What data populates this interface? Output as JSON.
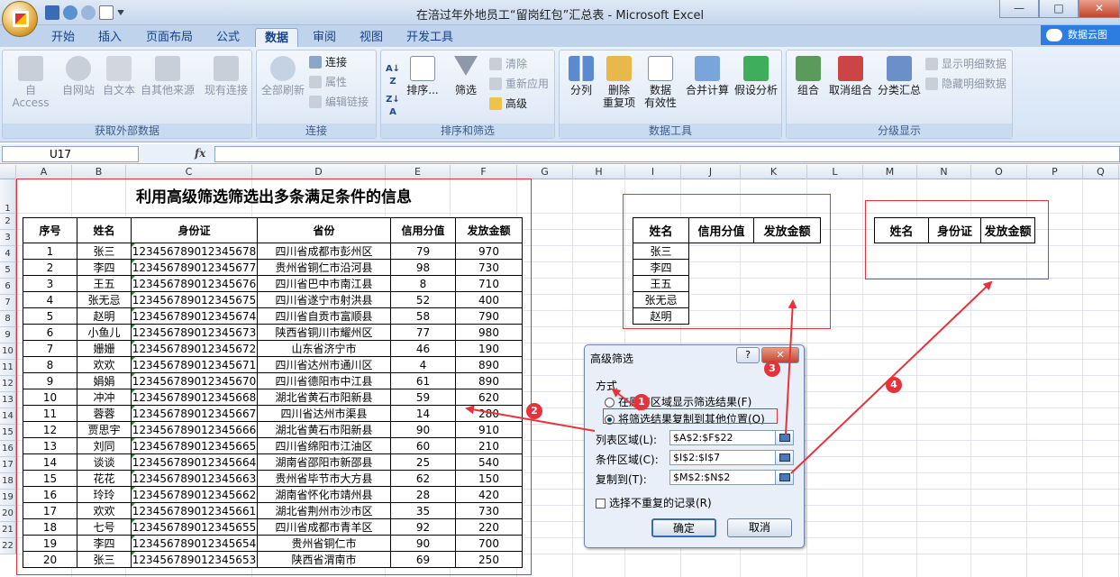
{
  "window": {
    "title": "在涪过年外地员工“留岗红包”汇总表 - Microsoft Excel",
    "controls": [
      "—",
      "□",
      "✕"
    ]
  },
  "ribbon_tabs": [
    "开始",
    "插入",
    "页面布局",
    "公式",
    "数据",
    "审阅",
    "视图",
    "开发工具"
  ],
  "active_tab": "数据",
  "cloud_button": "数据云图",
  "groups": {
    "external": {
      "label": "获取外部数据",
      "buttons": [
        "自 Access",
        "自网站",
        "自文本",
        "自其他来源",
        "现有连接"
      ]
    },
    "connections": {
      "label": "连接",
      "refresh": "全部刷新",
      "small": [
        "连接",
        "属性",
        "编辑链接"
      ]
    },
    "sort_filter": {
      "label": "排序和筛选",
      "sort": "排序...",
      "filter": "筛选",
      "small": [
        "清除",
        "重新应用",
        "高级"
      ]
    },
    "data_tools": {
      "label": "数据工具",
      "buttons": [
        "分列",
        "删除\n重复项",
        "数据\n有效性",
        "合并计算",
        "假设分析"
      ]
    },
    "outline": {
      "label": "分级显示",
      "buttons": [
        "组合",
        "取消组合",
        "分类汇总"
      ],
      "small": [
        "显示明细数据",
        "隐藏明细数据"
      ]
    }
  },
  "name_box": "U17",
  "fx_label": "fx",
  "columns": [
    "A",
    "B",
    "C",
    "D",
    "E",
    "F",
    "G",
    "H",
    "I",
    "J",
    "K",
    "L",
    "M",
    "N",
    "O",
    "P",
    "Q"
  ],
  "rows": [
    "1",
    "2",
    "3",
    "4",
    "5",
    "6",
    "7",
    "8",
    "9",
    "10",
    "11",
    "12",
    "13",
    "14",
    "15",
    "16",
    "17",
    "18",
    "19",
    "20",
    "21",
    "22"
  ],
  "main_table": {
    "title": "利用高级筛选筛选出多条满足条件的信息",
    "headers": [
      "序号",
      "姓名",
      "身份证",
      "省份",
      "信用分值",
      "发放金额"
    ],
    "rows": [
      [
        "1",
        "张三",
        "123456789012345678",
        "四川省成都市彭州区",
        "79",
        "970"
      ],
      [
        "2",
        "李四",
        "123456789012345677",
        "贵州省铜仁市沿河县",
        "98",
        "730"
      ],
      [
        "3",
        "王五",
        "123456789012345676",
        "四川省巴中市南江县",
        "8",
        "710"
      ],
      [
        "4",
        "张无忌",
        "123456789012345675",
        "四川省遂宁市射洪县",
        "52",
        "400"
      ],
      [
        "5",
        "赵明",
        "123456789012345674",
        "四川省自贡市富顺县",
        "58",
        "790"
      ],
      [
        "6",
        "小鱼儿",
        "123456789012345673",
        "陕西省铜川市耀州区",
        "77",
        "980"
      ],
      [
        "7",
        "姗姗",
        "123456789012345672",
        "山东省济宁市",
        "46",
        "190"
      ],
      [
        "8",
        "欢欢",
        "123456789012345671",
        "四川省达州市通川区",
        "4",
        "890"
      ],
      [
        "9",
        "娟娟",
        "123456789012345670",
        "四川省德阳市中江县",
        "61",
        "890"
      ],
      [
        "10",
        "冲冲",
        "123456789012345668",
        "湖北省黄石市阳新县",
        "59",
        "620"
      ],
      [
        "11",
        "蓉蓉",
        "123456789012345667",
        "四川省达州市渠县",
        "14",
        "280"
      ],
      [
        "12",
        "贾思宇",
        "123456789012345666",
        "湖北省黄石市阳新县",
        "90",
        "910"
      ],
      [
        "13",
        "刘同",
        "123456789012345665",
        "四川省绵阳市江油区",
        "60",
        "210"
      ],
      [
        "14",
        "谈谈",
        "123456789012345664",
        "湖南省邵阳市新邵县",
        "25",
        "540"
      ],
      [
        "15",
        "花花",
        "123456789012345663",
        "贵州省毕节市大方县",
        "62",
        "150"
      ],
      [
        "16",
        "玲玲",
        "123456789012345662",
        "湖南省怀化市靖州县",
        "28",
        "420"
      ],
      [
        "17",
        "欢欢",
        "123456789012345661",
        "湖北省荆州市沙市区",
        "35",
        "730"
      ],
      [
        "18",
        "七号",
        "123456789012345655",
        "四川省成都市青羊区",
        "92",
        "220"
      ],
      [
        "19",
        "李四",
        "123456789012345654",
        "贵州省铜仁市",
        "90",
        "700"
      ],
      [
        "20",
        "张三",
        "123456789012345653",
        "陕西省渭南市",
        "69",
        "250"
      ]
    ]
  },
  "criteria_table": {
    "headers": [
      "姓名",
      "信用分值",
      "发放金额"
    ],
    "names": [
      "张三",
      "李四",
      "王五",
      "张无忌",
      "赵明"
    ]
  },
  "output_table": {
    "headers": [
      "姓名",
      "身份证",
      "发放金额"
    ]
  },
  "dialog": {
    "title": "高级筛选",
    "help": "?",
    "close": "✕",
    "method_label": "方式",
    "option1": "在原有区域显示筛选结果(F)",
    "option2": "将筛选结果复制到其他位置(O)",
    "list_label": "列表区域(L):",
    "list_value": "$A$2:$F$22",
    "criteria_label": "条件区域(C):",
    "criteria_value": "$I$2:$I$7",
    "copyto_label": "复制到(T):",
    "copyto_value": "$M$2:$N$2",
    "unique_label": "选择不重复的记录(R)",
    "ok": "确定",
    "cancel": "取消"
  },
  "annotations": [
    "1",
    "2",
    "3",
    "4"
  ],
  "colors": {
    "annotation_red": "#e8323b",
    "ribbon_blue": "#15428b"
  }
}
